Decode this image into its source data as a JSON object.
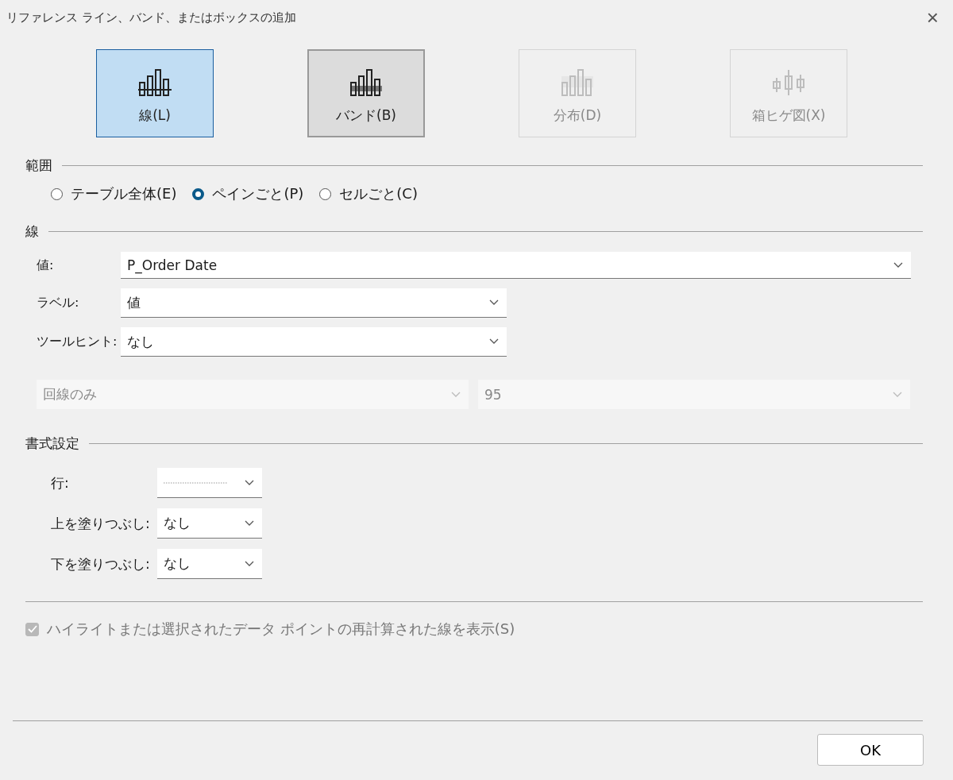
{
  "window": {
    "title": "リファレンス ライン、バンド、またはボックスの追加",
    "close": "×"
  },
  "types": [
    {
      "label": "線(L)",
      "kind": "line",
      "selected": true,
      "disabled": false
    },
    {
      "label": "バンド(B)",
      "kind": "band",
      "selected": false,
      "disabled": false
    },
    {
      "label": "分布(D)",
      "kind": "distribution",
      "selected": false,
      "disabled": true
    },
    {
      "label": "箱ヒゲ図(X)",
      "kind": "boxplot",
      "selected": false,
      "disabled": true
    }
  ],
  "scope": {
    "title": "範囲",
    "options": [
      {
        "label": "テーブル全体(E)",
        "selected": false
      },
      {
        "label": "ペインごと(P)",
        "selected": true
      },
      {
        "label": "セルごと(C)",
        "selected": false
      }
    ]
  },
  "line": {
    "title": "線",
    "fields": [
      {
        "label": "値:",
        "value": "P_Order Date"
      },
      {
        "label": "ラベル:",
        "value": "値"
      },
      {
        "label": "ツールヒント:",
        "value": "なし"
      }
    ],
    "disabled_fields": [
      {
        "value": "回線のみ",
        "disabled": true
      },
      {
        "value": "95",
        "disabled": true
      }
    ]
  },
  "format": {
    "title": "書式設定",
    "rows": [
      {
        "label": "行:",
        "kind": "line_style"
      },
      {
        "label": "上を塗りつぶし:",
        "kind": "text",
        "value": "なし"
      },
      {
        "label": "下を塗りつぶし:",
        "kind": "text",
        "value": "なし"
      }
    ]
  },
  "recalc": {
    "label": "ハイライトまたは選択されたデータ ポイントの再計算された線を表示(S)",
    "checked": true,
    "disabled": true
  },
  "buttons": [
    "OK"
  ]
}
